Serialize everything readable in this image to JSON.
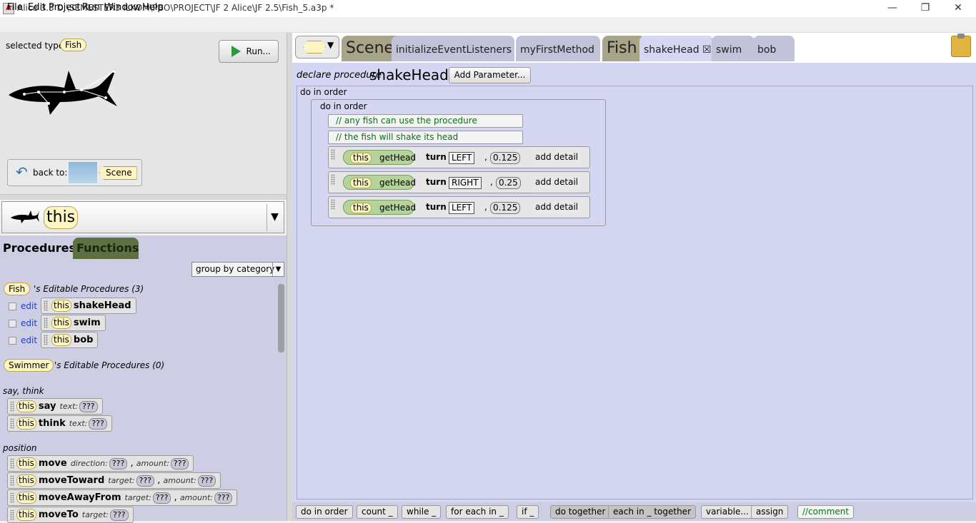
{
  "window": {
    "title": "Alice  3.3 D:\\SEMESTER3 ILKOM\\PBO\\PROJECT\\JF 2 Alice\\JF 2.5\\Fish_5.a3p *",
    "minimize": "—",
    "maximize": "❐",
    "close": "✕"
  },
  "menu": [
    "File",
    "Edit",
    "Project",
    "Run",
    "Window",
    "Help"
  ],
  "scene_panel": {
    "selected_type_label": "selected type:",
    "selected_type": "Fish",
    "run_label": "Run...",
    "back_to_label": "back to:",
    "back_to_target": "Scene"
  },
  "instance": {
    "name": "this",
    "arrow": "▼"
  },
  "palette_tabs": {
    "procedures": "Procedures",
    "functions": "Functions"
  },
  "group_by": {
    "value": "group by category",
    "arrow": "▼"
  },
  "editable_sections": [
    {
      "type": "Fish",
      "label": "'s Editable Procedures (3)"
    },
    {
      "type": "Swimmer",
      "label": "'s Editable Procedures (0)"
    }
  ],
  "editable_procedures": [
    {
      "edit": "edit",
      "this": "this",
      "name": "shakeHead"
    },
    {
      "edit": "edit",
      "this": "this",
      "name": "swim"
    },
    {
      "edit": "edit",
      "this": "this",
      "name": "bob"
    }
  ],
  "categories": {
    "say_think": "say, think",
    "position": "position"
  },
  "say_think": [
    {
      "this": "this",
      "name": "say",
      "p1": "text:",
      "p1v": "???"
    },
    {
      "this": "this",
      "name": "think",
      "p1": "text:",
      "p1v": "???"
    }
  ],
  "position": [
    {
      "this": "this",
      "name": "move",
      "p1": "direction:",
      "p1v": "???",
      "p2": "amount:",
      "p2v": "???"
    },
    {
      "this": "this",
      "name": "moveToward",
      "p1": "target:",
      "p1v": "???",
      "p2": "amount:",
      "p2v": "???"
    },
    {
      "this": "this",
      "name": "moveAwayFrom",
      "p1": "target:",
      "p1v": "???",
      "p2": "amount:",
      "p2v": "???"
    },
    {
      "this": "this",
      "name": "moveTo",
      "p1": "target:",
      "p1v": "???"
    }
  ],
  "editor_tabs": {
    "scene": "Scene",
    "initialize": "initializeEventListeners",
    "my_first": "myFirstMethod",
    "fish": "Fish",
    "shake": "shakeHead",
    "shake_close": "☒",
    "swim": "swim",
    "bob": "bob"
  },
  "declaration": {
    "declare": "declare procedure",
    "name": "shakeHead",
    "add_param": "Add Parameter..."
  },
  "code": {
    "outer": "do in order",
    "inner": "do in order",
    "comments": [
      "// any fish can use the procedure",
      "// the fish will shake its head"
    ],
    "statements": [
      {
        "this": "this",
        "get": "getHead",
        "turn": "turn",
        "dir": "LEFT",
        "comma": ",",
        "amount": "0.125",
        "detail": "add detail"
      },
      {
        "this": "this",
        "get": "getHead",
        "turn": "turn",
        "dir": "RIGHT",
        "comma": ",",
        "amount": "0.25",
        "detail": "add detail"
      },
      {
        "this": "this",
        "get": "getHead",
        "turn": "turn",
        "dir": "LEFT",
        "comma": ",",
        "amount": "0.125",
        "detail": "add detail"
      }
    ]
  },
  "toolbar": {
    "do_in_order": "do in order",
    "count": "count _",
    "while": "while _",
    "for_each": "for each in _",
    "if": "if _",
    "do_together": "do together",
    "each_together": "each in _ together",
    "variable": "variable...",
    "assign": "assign",
    "comment": "//comment"
  },
  "colors": {
    "palette_bg": "#cdcde4",
    "editor_bg": "#d5d6f1",
    "instance_yellow": "#fdf6c3",
    "functions_tab": "#5c7040",
    "comment_green": "#0c6e1c",
    "gethead_green": "#b5d49a"
  }
}
